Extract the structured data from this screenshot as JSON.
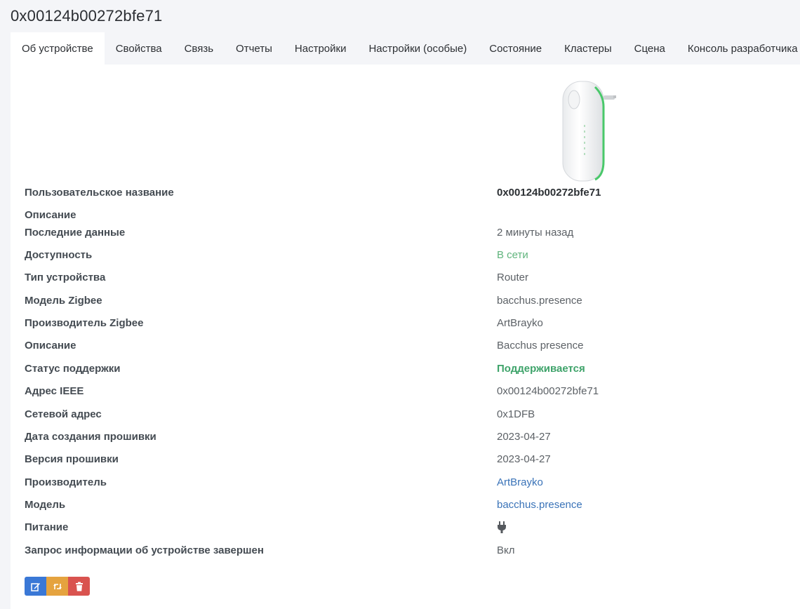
{
  "header": {
    "title": "0x00124b00272bfe71"
  },
  "tabs": [
    {
      "label": "Об устройстве",
      "active": true
    },
    {
      "label": "Свойства"
    },
    {
      "label": "Связь"
    },
    {
      "label": "Отчеты"
    },
    {
      "label": "Настройки"
    },
    {
      "label": "Настройки (особые)"
    },
    {
      "label": "Состояние"
    },
    {
      "label": "Кластеры"
    },
    {
      "label": "Сцена"
    },
    {
      "label": "Консоль разработчика"
    }
  ],
  "device": {
    "image_icon": "zigbee-router-plug-image"
  },
  "details": {
    "friendly_name": {
      "label": "Пользовательское название",
      "value": "0x00124b00272bfe71"
    },
    "description": {
      "label": "Описание",
      "value": ""
    },
    "last_seen": {
      "label": "Последние данные",
      "value": "2 минуты назад"
    },
    "availability": {
      "label": "Доступность",
      "value": "В сети"
    },
    "device_type": {
      "label": "Тип устройства",
      "value": "Router"
    },
    "zigbee_model": {
      "label": "Модель Zigbee",
      "value": "bacchus.presence"
    },
    "zigbee_manufacturer": {
      "label": "Производитель Zigbee",
      "value": "ArtBrayko"
    },
    "description2": {
      "label": "Описание",
      "value": "Bacchus presence"
    },
    "support_status": {
      "label": "Статус поддержки",
      "value": "Поддерживается"
    },
    "ieee_address": {
      "label": "Адрес IEEE",
      "value": "0x00124b00272bfe71"
    },
    "network_address": {
      "label": "Сетевой адрес",
      "value": "0x1DFB"
    },
    "firmware_date": {
      "label": "Дата создания прошивки",
      "value": "2023-04-27"
    },
    "firmware_version": {
      "label": "Версия прошивки",
      "value": "2023-04-27"
    },
    "manufacturer": {
      "label": "Производитель",
      "value": "ArtBrayko"
    },
    "model": {
      "label": "Модель",
      "value": "bacchus.presence"
    },
    "power": {
      "label": "Питание",
      "icon": "plug-icon"
    },
    "interview": {
      "label": "Запрос информации об устройстве завершен",
      "value": "Вкл"
    }
  },
  "actions": {
    "edit_icon": "edit-icon",
    "reconfigure_icon": "retweet-icon",
    "remove_icon": "trash-icon"
  },
  "colors": {
    "online": "#5fb47c",
    "supported": "#3ea36a",
    "link": "#3a73b8",
    "btn_edit": "#3a78d6",
    "btn_reconfigure": "#e5a33f",
    "btn_remove": "#d9534f"
  }
}
